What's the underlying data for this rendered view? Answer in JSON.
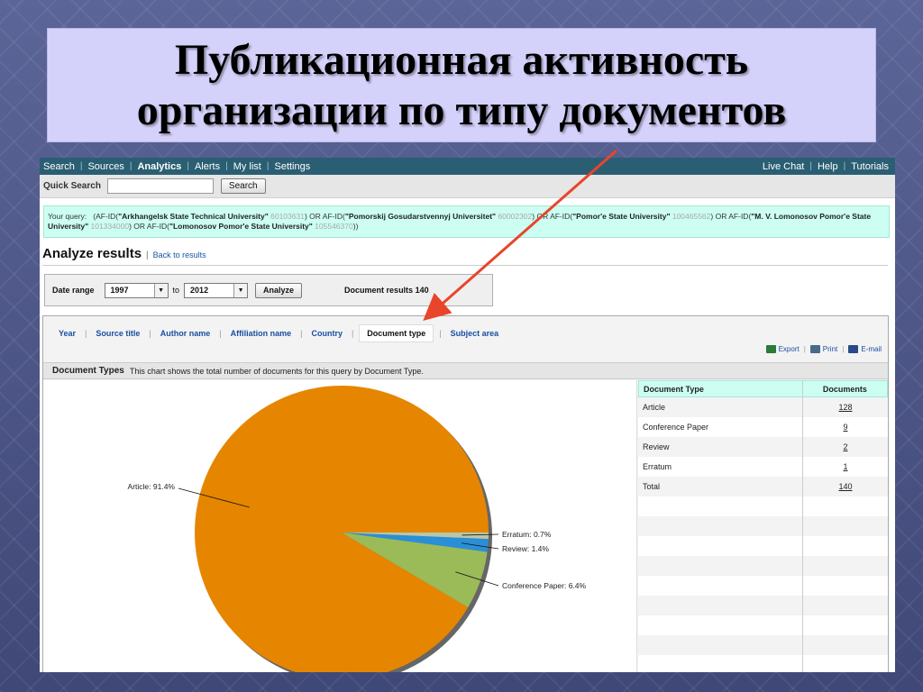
{
  "slide": {
    "title_line1": "Публикационная активность",
    "title_line2": "организации по типу документов"
  },
  "nav": {
    "left": [
      "Search",
      "Sources",
      "Analytics",
      "Alerts",
      "My list",
      "Settings"
    ],
    "right": [
      "Live Chat",
      "Help",
      "Tutorials"
    ]
  },
  "quick_search": {
    "label": "Quick Search",
    "value": "",
    "button": "Search"
  },
  "query": {
    "prefix": "Your query:",
    "terms": [
      {
        "pre": "(AF-ID(",
        "name": "\"Arkhangelsk State Technical University\"",
        "id": "60103631",
        "post": ") OR "
      },
      {
        "pre": "AF-ID(",
        "name": "\"Pomorskij Gosudarstvennyj Universitet\"",
        "id": "60002302",
        "post": ") OR "
      },
      {
        "pre": "AF-ID(",
        "name": "\"Pomor'e State University\"",
        "id": "100465562",
        "post": ") OR "
      },
      {
        "pre": "AF-ID(",
        "name": "\"M. V. Lomonosov Pomor'e State University\"",
        "id": "101334000",
        "post": ") OR "
      },
      {
        "pre": "AF-ID(",
        "name": "\"Lomonosov Pomor'e State University\"",
        "id": "105546370",
        "post": "))"
      }
    ]
  },
  "analyze": {
    "title": "Analyze results",
    "back_link": "Back to results"
  },
  "date_range": {
    "label": "Date range",
    "from": "1997",
    "to_label": "to",
    "to": "2012",
    "button": "Analyze",
    "doc_results": "Document results 140"
  },
  "tabs": [
    {
      "label": "Year",
      "active": false
    },
    {
      "label": "Source title",
      "active": false
    },
    {
      "label": "Author name",
      "active": false
    },
    {
      "label": "Affiliation name",
      "active": false
    },
    {
      "label": "Country",
      "active": false
    },
    {
      "label": "Document type",
      "active": true
    },
    {
      "label": "Subject area",
      "active": false
    }
  ],
  "actions": {
    "export": "Export",
    "print": "Print",
    "email": "E-mail"
  },
  "doc_types": {
    "heading": "Document Types",
    "description": "This chart shows the total number of documents for this query by Document Type."
  },
  "table": {
    "headers": [
      "Document Type",
      "Documents"
    ],
    "rows": [
      {
        "type": "Article",
        "count": "128"
      },
      {
        "type": "Conference Paper",
        "count": "9"
      },
      {
        "type": "Review",
        "count": "2"
      },
      {
        "type": "Erratum",
        "count": "1"
      },
      {
        "type": "Total",
        "count": "140"
      }
    ]
  },
  "colors": {
    "article": "#e68600",
    "conference": "#9bbb59",
    "review": "#2a8fd6",
    "erratum": "#b9c7a9",
    "arrow": "#e8452b"
  },
  "chart_data": {
    "type": "pie",
    "slices": [
      {
        "label": "Article: 91.4%",
        "value": 91.4,
        "color": "#e68600"
      },
      {
        "label": "Conference Paper: 6.4%",
        "value": 6.4,
        "color": "#9bbb59"
      },
      {
        "label": "Review: 1.4%",
        "value": 1.4,
        "color": "#2a8fd6"
      },
      {
        "label": "Erratum: 0.7%",
        "value": 0.7,
        "color": "#b9c7a9"
      }
    ]
  }
}
